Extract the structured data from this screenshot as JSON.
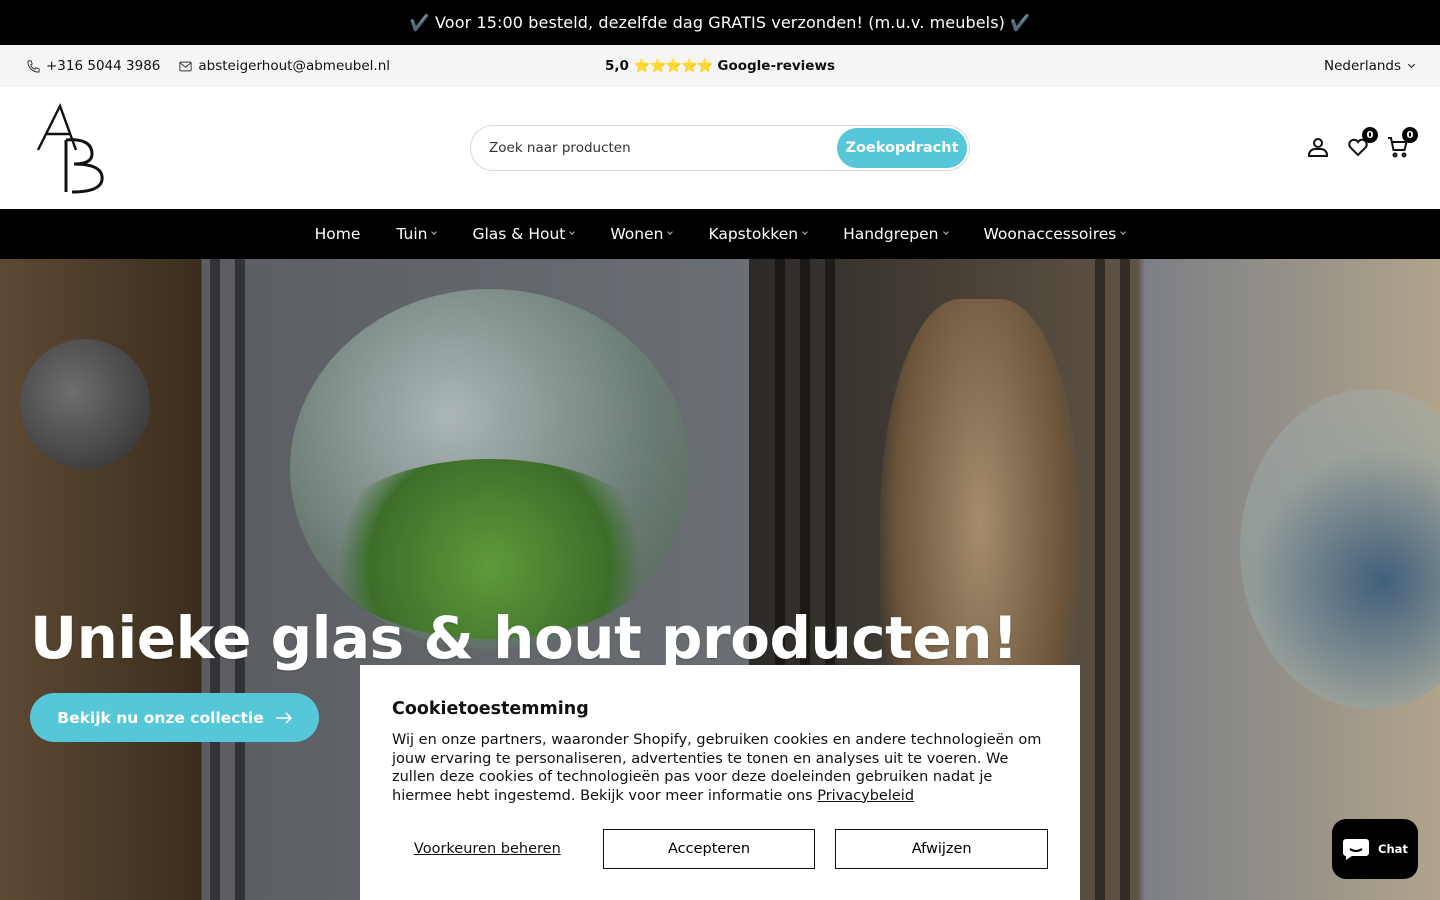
{
  "announcement": {
    "text": "✔️ Voor 15:00 besteld, dezelfde dag GRATIS verzonden! (m.u.v. meubels) ✔️"
  },
  "topbar": {
    "phone": "+316 5044 3986",
    "email": "absteigerhout@abmeubel.nl",
    "rating": "5,0",
    "stars": "⭐⭐⭐⭐⭐",
    "reviews_label": "Google-reviews",
    "language": "Nederlands"
  },
  "header": {
    "logo_text": "AB",
    "search_placeholder": "Zoek naar producten",
    "search_button": "Zoekopdracht",
    "wishlist_count": "0",
    "cart_count": "0"
  },
  "nav": {
    "items": [
      {
        "label": "Home"
      },
      {
        "label": "Tuin"
      },
      {
        "label": "Glas & Hout"
      },
      {
        "label": "Wonen"
      },
      {
        "label": "Kapstokken"
      },
      {
        "label": "Handgrepen"
      },
      {
        "label": "Woonaccessoires"
      }
    ]
  },
  "hero": {
    "title": "Unieke glas & hout producten!",
    "cta": "Bekijk nu onze collectie"
  },
  "cookie": {
    "title": "Cookietoestemming",
    "text": "Wij en onze partners, waaronder Shopify, gebruiken cookies en andere technologieën om jouw ervaring te personaliseren, advertenties te tonen en analyses uit te voeren. We zullen deze cookies of technologieën pas voor deze doeleinden gebruiken nadat je hiermee hebt ingestemd. Bekijk voor meer informatie ons",
    "link": "Privacybeleid",
    "manage": "Voorkeuren beheren",
    "accept": "Accepteren",
    "decline": "Afwijzen"
  },
  "chat": {
    "label": "Chat"
  },
  "colors": {
    "accent": "#56c7d8",
    "dark": "#000000",
    "topbar_bg": "#f4f5f7"
  }
}
